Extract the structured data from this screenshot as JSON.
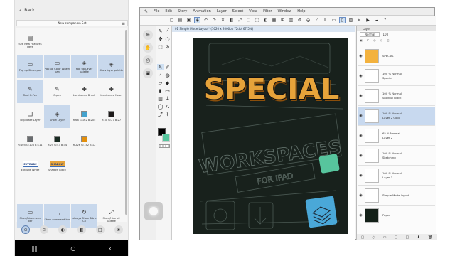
{
  "phone": {
    "back_label": "Back",
    "set_name": "New companion Set",
    "cells": [
      {
        "label": "See New Features Here",
        "icon": "▤"
      },
      {
        "label": "Pop up Slider pan",
        "icon": "▭"
      },
      {
        "label": "Pop up Color Wheel pan",
        "icon": "▭"
      },
      {
        "label": "Pop up Layer palette",
        "icon": "◈"
      },
      {
        "label": "Show layer palette",
        "icon": "◈"
      },
      {
        "label": "Real G-Pen",
        "icon": "✎"
      },
      {
        "label": "G-pen",
        "icon": "✎"
      },
      {
        "label": "Luminance Brush",
        "icon": "✚"
      },
      {
        "label": "Luminance Neon",
        "icon": "✚"
      },
      {
        "label": "Duplicate Layer",
        "icon": "❏"
      },
      {
        "label": "Show Layer",
        "icon": "◈"
      },
      {
        "label": "R:68 G:162 B:205",
        "color": "#44a2cd"
      },
      {
        "label": "R:30 G:27 B:27",
        "color": "#1e1b1b"
      },
      {
        "label": "R:105 G:108 B:111",
        "color": "#696c6f"
      },
      {
        "label": "R:25 G:43 B:34",
        "color": "#192b22"
      },
      {
        "label": "R:226 G:142 B:12",
        "color": "#e28e0c"
      },
      {
        "label": "Extrude White",
        "icon": "EXTRUDE"
      },
      {
        "label": "Shadow Black",
        "icon": "SHADOW"
      },
      {
        "label": "Show/hide menu bar",
        "icon": "▭"
      },
      {
        "label": "Show command bar",
        "icon": "▭"
      },
      {
        "label": "Always Show Tab a Co",
        "icon": "↻"
      },
      {
        "label": "Show/hide all palette",
        "icon": "⤢"
      }
    ],
    "bottom_tools": [
      "⊕",
      "⊡",
      "◐",
      "◧",
      "◫",
      "❀"
    ],
    "nav_icons": [
      "‖‖",
      "○",
      "‹"
    ]
  },
  "app": {
    "menu": [
      "File",
      "Edit",
      "Story",
      "Animation",
      "Layer",
      "Select",
      "View",
      "Filter",
      "Window",
      "Help"
    ],
    "doc_title": "01 Simple Mode Layout* (1620 x 2000px 72dpi 67.5%)",
    "artwork": {
      "title": "SPECIAL",
      "subtitle": "WORKSPACES",
      "caption": "FOR IPAD"
    },
    "layer_panel": {
      "tab": "Layer",
      "blend": "Normal",
      "opacity": "100",
      "layers": [
        {
          "name": "SPECIAL",
          "info": "",
          "selected": false,
          "thumb": "#f3b23e"
        },
        {
          "name": "Special",
          "info": "100 % Normal",
          "selected": false,
          "thumb": "#ffffff"
        },
        {
          "name": "Shadow Black",
          "info": "100 % Normal",
          "selected": false,
          "thumb": "#ffffff"
        },
        {
          "name": "Layer 2 Copy",
          "info": "100 % Normal",
          "selected": true,
          "thumb": "#ffffff"
        },
        {
          "name": "Layer 2",
          "info": "65 % Normal",
          "selected": false,
          "thumb": "#ffffff"
        },
        {
          "name": "Sketching",
          "info": "100 % Normal",
          "selected": false,
          "thumb": "#ffffff"
        },
        {
          "name": "Layer 1",
          "info": "100 % Normal",
          "selected": false,
          "thumb": "#ffffff"
        },
        {
          "name": "Simple Mode layout",
          "info": "",
          "selected": false,
          "thumb": "#ffffff"
        },
        {
          "name": "Paper",
          "info": "",
          "selected": false,
          "thumb": "#132018"
        }
      ]
    }
  },
  "colors": {
    "accent": "#e6a33a",
    "selection": "#c8d9ef",
    "artboard": "#18211c",
    "cyan": "#4aa8d8",
    "mint": "#57c59d"
  }
}
